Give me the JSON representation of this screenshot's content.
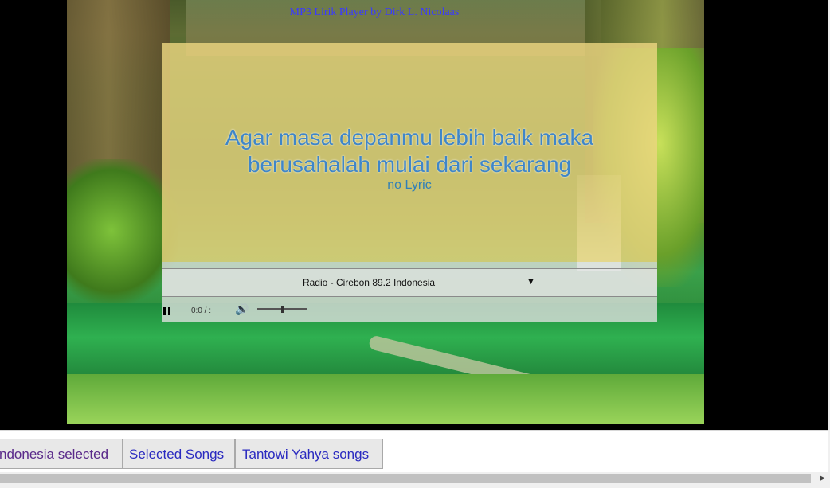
{
  "app_title": "MP3 Lirik Player by Dirk L. Nicolaas",
  "lyric": {
    "main_line1": "Agar masa depanmu lebih baik maka",
    "main_line2": "berusahalah mulai dari sekarang",
    "sub": "no Lyric"
  },
  "player": {
    "station": "Radio - Cirebon 89.2 Indonesia",
    "time": "0:0 / :",
    "volume": 0.5
  },
  "tabs": [
    {
      "label": "ndonesia selected"
    },
    {
      "label": "Selected Songs"
    },
    {
      "label": "Tantowi Yahya songs"
    }
  ],
  "icons": {
    "pause": "pause-icon",
    "volume": "speaker-icon",
    "dropdown": "triangle-down-icon",
    "scroll_right": "triangle-right-icon"
  }
}
